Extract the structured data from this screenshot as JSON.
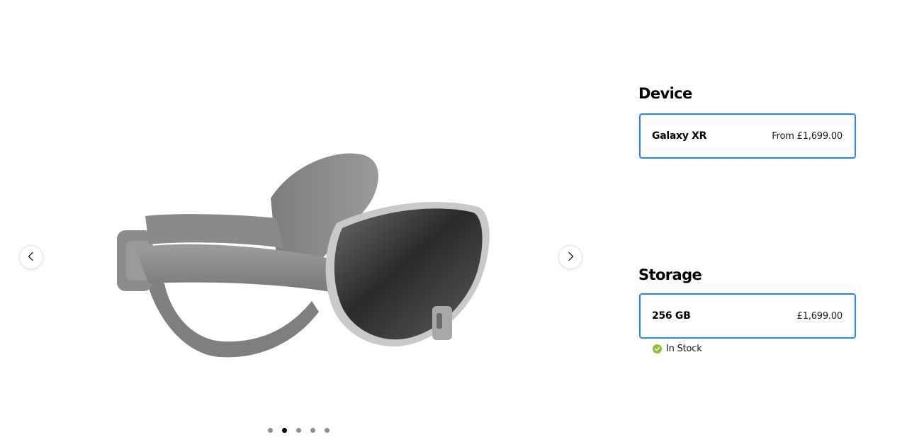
{
  "gallery": {
    "prev_icon": "chevron-left-icon",
    "next_icon": "chevron-right-icon",
    "image_subject": "headset-image",
    "slides": [
      {
        "active": false
      },
      {
        "active": true
      },
      {
        "active": false
      },
      {
        "active": false
      },
      {
        "active": false
      }
    ]
  },
  "device": {
    "title": "Device",
    "option": {
      "name": "Galaxy XR",
      "price": "From £1,699.00"
    }
  },
  "storage": {
    "title": "Storage",
    "option": {
      "name": "256 GB",
      "price": "£1,699.00"
    },
    "stock": {
      "icon": "check-circle-icon",
      "label": "In Stock"
    }
  },
  "colors": {
    "selection_border": "#2189ff",
    "in_stock": "#8ac534",
    "dot_active": "#000000",
    "dot_inactive": "#8f8f8f"
  }
}
